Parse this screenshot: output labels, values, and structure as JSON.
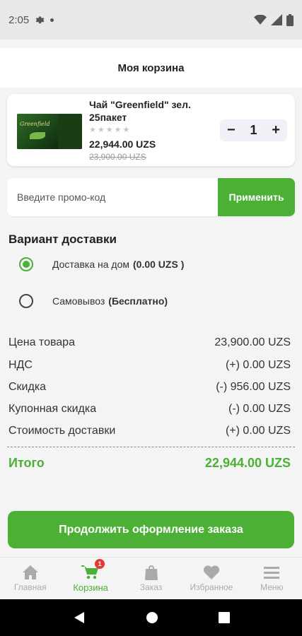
{
  "status_bar": {
    "time": "2:05"
  },
  "header": {
    "title": "Моя корзина"
  },
  "cart": {
    "items": [
      {
        "name": "Чай \"Greenfield\" зел. 25пакет",
        "image_brand": "Greenfield",
        "rating_stars": 0,
        "price": "22,944.00 UZS",
        "old_price": "23,900.00 UZS",
        "quantity": "1"
      }
    ]
  },
  "promo": {
    "placeholder": "Введите промо-код",
    "apply_label": "Применить"
  },
  "delivery": {
    "title": "Вариант доставки",
    "options": [
      {
        "label": "Доставка на дом",
        "extra": "(0.00 UZS )",
        "selected": true
      },
      {
        "label": "Самовывоз",
        "extra": "(Бесплатно)",
        "selected": false
      }
    ]
  },
  "summary": {
    "rows": [
      {
        "label": "Цена товара",
        "value": "23,900.00 UZS"
      },
      {
        "label": "НДС",
        "value": "(+) 0.00 UZS"
      },
      {
        "label": "Скидка",
        "value": "(-) 956.00 UZS"
      },
      {
        "label": "Купонная скидка",
        "value": "(-) 0.00 UZS"
      },
      {
        "label": "Стоимость доставки",
        "value": "(+) 0.00 UZS"
      }
    ],
    "total_label": "Итого",
    "total_value": "22,944.00 UZS"
  },
  "checkout": {
    "label": "Продолжить оформление заказа"
  },
  "bottom_nav": {
    "items": [
      {
        "label": "Главная",
        "icon": "home-icon"
      },
      {
        "label": "Корзина",
        "icon": "cart-icon",
        "badge": "1",
        "active": true
      },
      {
        "label": "Заказ",
        "icon": "bag-icon"
      },
      {
        "label": "Избранное",
        "icon": "heart-icon"
      },
      {
        "label": "Меню",
        "icon": "menu-icon"
      }
    ]
  },
  "colors": {
    "accent": "#4caf36",
    "badge": "#e53935"
  }
}
